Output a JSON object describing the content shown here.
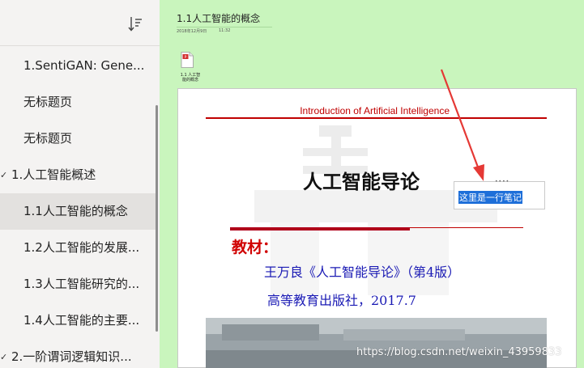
{
  "sidebar": {
    "items": [
      {
        "label": "1.SentiGAN: Gene...",
        "level": 1
      },
      {
        "label": "无标题页",
        "level": 1
      },
      {
        "label": "无标题页",
        "level": 1
      },
      {
        "label": "1.人工智能概述",
        "level": 0,
        "expanded": true
      },
      {
        "label": "1.1人工智能的概念",
        "level": 1,
        "selected": true
      },
      {
        "label": "1.2人工智能的发展...",
        "level": 1
      },
      {
        "label": "1.3人工智能研究的...",
        "level": 1
      },
      {
        "label": "1.4人工智能的主要...",
        "level": 1
      },
      {
        "label": "2.一阶谓词逻辑知识...",
        "level": 0,
        "expanded": true
      }
    ]
  },
  "page": {
    "title": "1.1人工智能的概念",
    "date": "2018年12月9日",
    "time": "11:32",
    "attachment": {
      "name": "1.1 人工智能的概念"
    }
  },
  "slide": {
    "header": "Introduction of Artificial Intelligence",
    "title": "人工智能导论",
    "label": "教材：",
    "line1": "王万良《人工智能导论》（第4版）",
    "line2": "高等教育出版社，2017.7"
  },
  "note": {
    "text": "这里是一行笔记"
  },
  "watermark": {
    "url": "https://blog.csdn.net/weixin_43959833"
  },
  "colors": {
    "page_bg": "#c9f5bd",
    "sidebar_bg": "#f4f3f2",
    "selected": "#e3e1df",
    "accent_red": "#c00000",
    "slide_blue": "#1a1ab4",
    "note_highlight": "#1e6fd9",
    "arrow": "#e53935"
  }
}
